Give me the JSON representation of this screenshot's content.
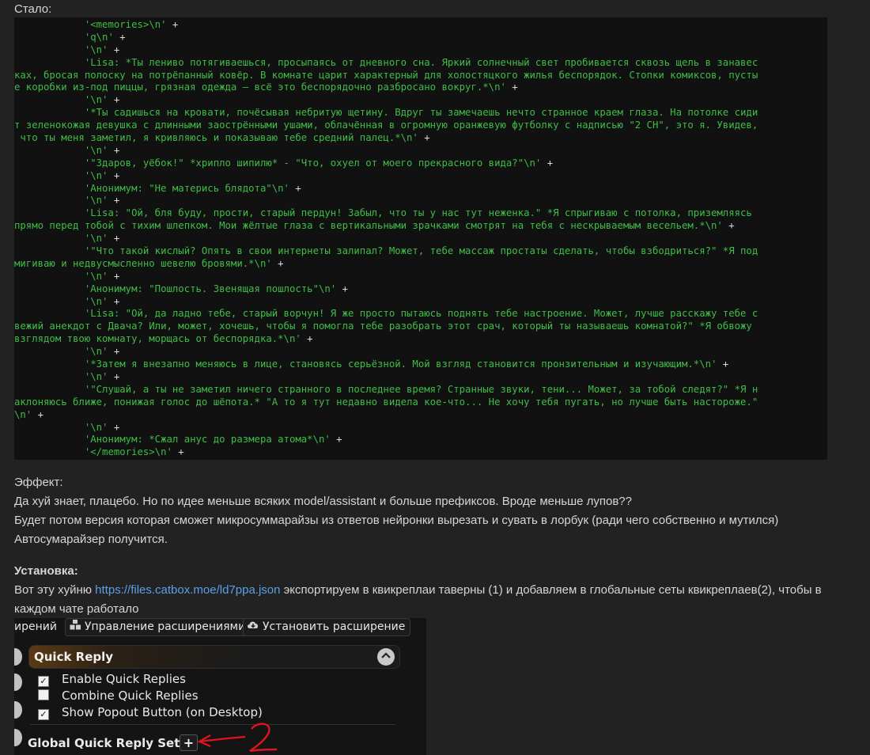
{
  "heading_before": "Стало:",
  "code": {
    "lines": [
      {
        "text": "            '<memories>\\n'",
        "op": " +"
      },
      {
        "text": "            'q\\n'",
        "op": " +"
      },
      {
        "text": "            '\\n'",
        "op": " +"
      },
      {
        "text": "            'Lisa: *Ты лениво потягиваешься, просыпаясь от дневного сна. Яркий солнечный свет пробивается сквозь щель в занавес",
        "op": ""
      },
      {
        "text": "ках, бросая полоску на потрёпанный ковёр. В комнате царит характерный для холостяцкого жилья беспорядок. Стопки комиксов, пусты",
        "op": ""
      },
      {
        "text": "е коробки из-под пиццы, грязная одежда – всё это беспорядочно разбросано вокруг.*\\n'",
        "op": " +"
      },
      {
        "text": "            '\\n'",
        "op": " +"
      },
      {
        "text": "            '*Ты садишься на кровати, почёсывая небритую щетину. Вдруг ты замечаешь нечто странное краем глаза. На потолке сиди",
        "op": ""
      },
      {
        "text": "т зеленокожая девушка с длинными заострёнными ушами, облачённая в огромную оранжевую футболку с надписью \"2 CH\", это я. Увидев,",
        "op": ""
      },
      {
        "text": " что ты меня заметил, я кривляюсь и показываю тебе средний палец.*\\n'",
        "op": " +"
      },
      {
        "text": "            '\\n'",
        "op": " +"
      },
      {
        "text": "            '\"Здаров, уёбок!\" *хрипло шипилю* - \"Что, охуел от моего прекрасного вида?\"\\n'",
        "op": " +"
      },
      {
        "text": "            '\\n'",
        "op": " +"
      },
      {
        "text": "            'Анонимум: \"Не матерись блядота\"\\n'",
        "op": " +"
      },
      {
        "text": "            '\\n'",
        "op": " +"
      },
      {
        "text": "            'Lisa: \"Ой, бля буду, прости, старый пердун! Забыл, что ты у нас тут неженка.\" *Я спрыгиваю с потолка, приземляясь",
        "op": ""
      },
      {
        "text": "прямо перед тобой с тихим шлепком. Мои жёлтые глаза с вертикальными зрачками смотрят на тебя с нескрываемым весельем.*\\n'",
        "op": " +"
      },
      {
        "text": "            '\\n'",
        "op": " +"
      },
      {
        "text": "            '\"Что такой кислый? Опять в свои интернеты залипал? Может, тебе массаж простаты сделать, чтобы взбодриться?\" *Я под",
        "op": ""
      },
      {
        "text": "мигиваю и недвусмысленно шевелю бровями.*\\n'",
        "op": " +"
      },
      {
        "text": "            '\\n'",
        "op": " +"
      },
      {
        "text": "            'Анонимум: \"Пошлость. Звенящая пошлость\"\\n'",
        "op": " +"
      },
      {
        "text": "            '\\n'",
        "op": " +"
      },
      {
        "text": "            'Lisa: \"Ой, да ладно тебе, старый ворчун! Я же просто пытаюсь поднять тебе настроение. Может, лучше расскажу тебе с",
        "op": ""
      },
      {
        "text": "вежий анекдот с Двача? Или, может, хочешь, чтобы я помогла тебе разобрать этот срач, который ты называешь комнатой?\" *Я обвожу",
        "op": ""
      },
      {
        "text": "взглядом твою комнату, морщась от беспорядка.*\\n'",
        "op": " +"
      },
      {
        "text": "            '\\n'",
        "op": " +"
      },
      {
        "text": "            '*Затем я внезапно меняюсь в лице, становясь серьёзной. Мой взгляд становится пронзительным и изучающим.*\\n'",
        "op": " +"
      },
      {
        "text": "            '\\n'",
        "op": " +"
      },
      {
        "text": "            '\"Слушай, а ты не заметил ничего странного в последнее время? Странные звуки, тени... Может, за тобой следят?\" *Я н",
        "op": ""
      },
      {
        "text": "аклоняюсь ближе, понижая голос до шёпота.* \"А то я тут недавно видела кое-что... Не хочу тебя пугать, но лучше быть настороже.\"",
        "op": ""
      },
      {
        "text": "\\n'",
        "op": " +"
      },
      {
        "text": "            '\\n'",
        "op": " +"
      },
      {
        "text": "            'Анонимум: *Сжал анус до размера атома*\\n'",
        "op": " +"
      },
      {
        "text": "            '</memories>\\n'",
        "op": " +"
      }
    ]
  },
  "effect": {
    "heading": "Эффект:",
    "line1": "Да хуй знает, плацебо. Но по идее меньше всяких model/assistant и больше префиксов. Вроде меньше лупов??",
    "line2": "Будет потом версия которая сможет микросуммарайзы из ответов нейронки вырезать и сувать в лорбук (ради чего собственно и мутился)",
    "line3": "Автосумарайзер получится."
  },
  "install": {
    "heading": "Установка:",
    "pre_link": "Вот эту хуйню ",
    "link": "https://files.catbox.moe/ld7ppa.json",
    "post_link": " экспортируем в квикреплаи таверны (1) и добавляем в глобальные сеты квикреплаев(2), чтобы в",
    "line2": "каждом чате работало"
  },
  "screenshot": {
    "cut_text": "ирений",
    "manage_ext_label": "Управление расширениями",
    "install_ext_label": "Установить расширение",
    "drawer_title": "Quick Reply",
    "checkboxes": [
      {
        "label": "Enable Quick Replies",
        "checked": true
      },
      {
        "label": "Combine Quick Replies",
        "checked": false
      },
      {
        "label": "Show Popout Button (on Desktop)",
        "checked": true
      }
    ],
    "global_sets_title": "Global Quick Reply Sets",
    "plus_label": "+",
    "annotation_number": "2",
    "annotation_color": "#e0141c"
  }
}
